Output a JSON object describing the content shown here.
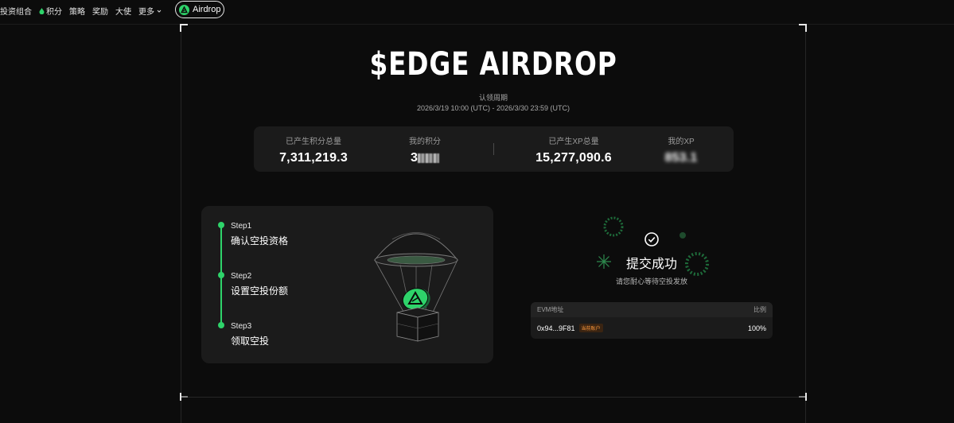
{
  "nav": {
    "items": [
      {
        "label": "投资组合",
        "icon": ""
      },
      {
        "label": "积分",
        "icon": "drop-icon"
      },
      {
        "label": "策略",
        "icon": ""
      },
      {
        "label": "奖励",
        "icon": ""
      },
      {
        "label": "大使",
        "icon": ""
      },
      {
        "label": "更多",
        "icon": "chevron-down-icon"
      }
    ],
    "airdrop_label": "Airdrop"
  },
  "hero": {
    "title": "$EDGE AIRDROP",
    "claim_label": "认领周期",
    "claim_dates": "2026/3/19 10:00 (UTC) - 2026/3/30 23:59 (UTC)"
  },
  "stats": {
    "total_points_label": "已产生积分总量",
    "total_points_value": "7,311,219.3",
    "my_points_label": "我的积分",
    "my_points_value": "3",
    "total_xp_label": "已产生XP总量",
    "total_xp_value": "15,277,090.6",
    "my_xp_label": "我的XP",
    "my_xp_value": "853.1"
  },
  "steps": [
    {
      "num": "Step1",
      "text": "确认空投资格"
    },
    {
      "num": "Step2",
      "text": "设置空投份额"
    },
    {
      "num": "Step3",
      "text": "领取空投"
    }
  ],
  "success": {
    "title": "提交成功",
    "subtitle": "请您耐心等待空投发放"
  },
  "evm_table": {
    "col_address": "EVM地址",
    "col_ratio": "比例",
    "row": {
      "address": "0x94...9F81",
      "badge": "当前账户",
      "ratio": "100%"
    }
  },
  "colors": {
    "accent": "#2ed36a",
    "badge": "#ff9a3c",
    "bg": "#0c0c0c",
    "card": "#1b1b1b"
  }
}
